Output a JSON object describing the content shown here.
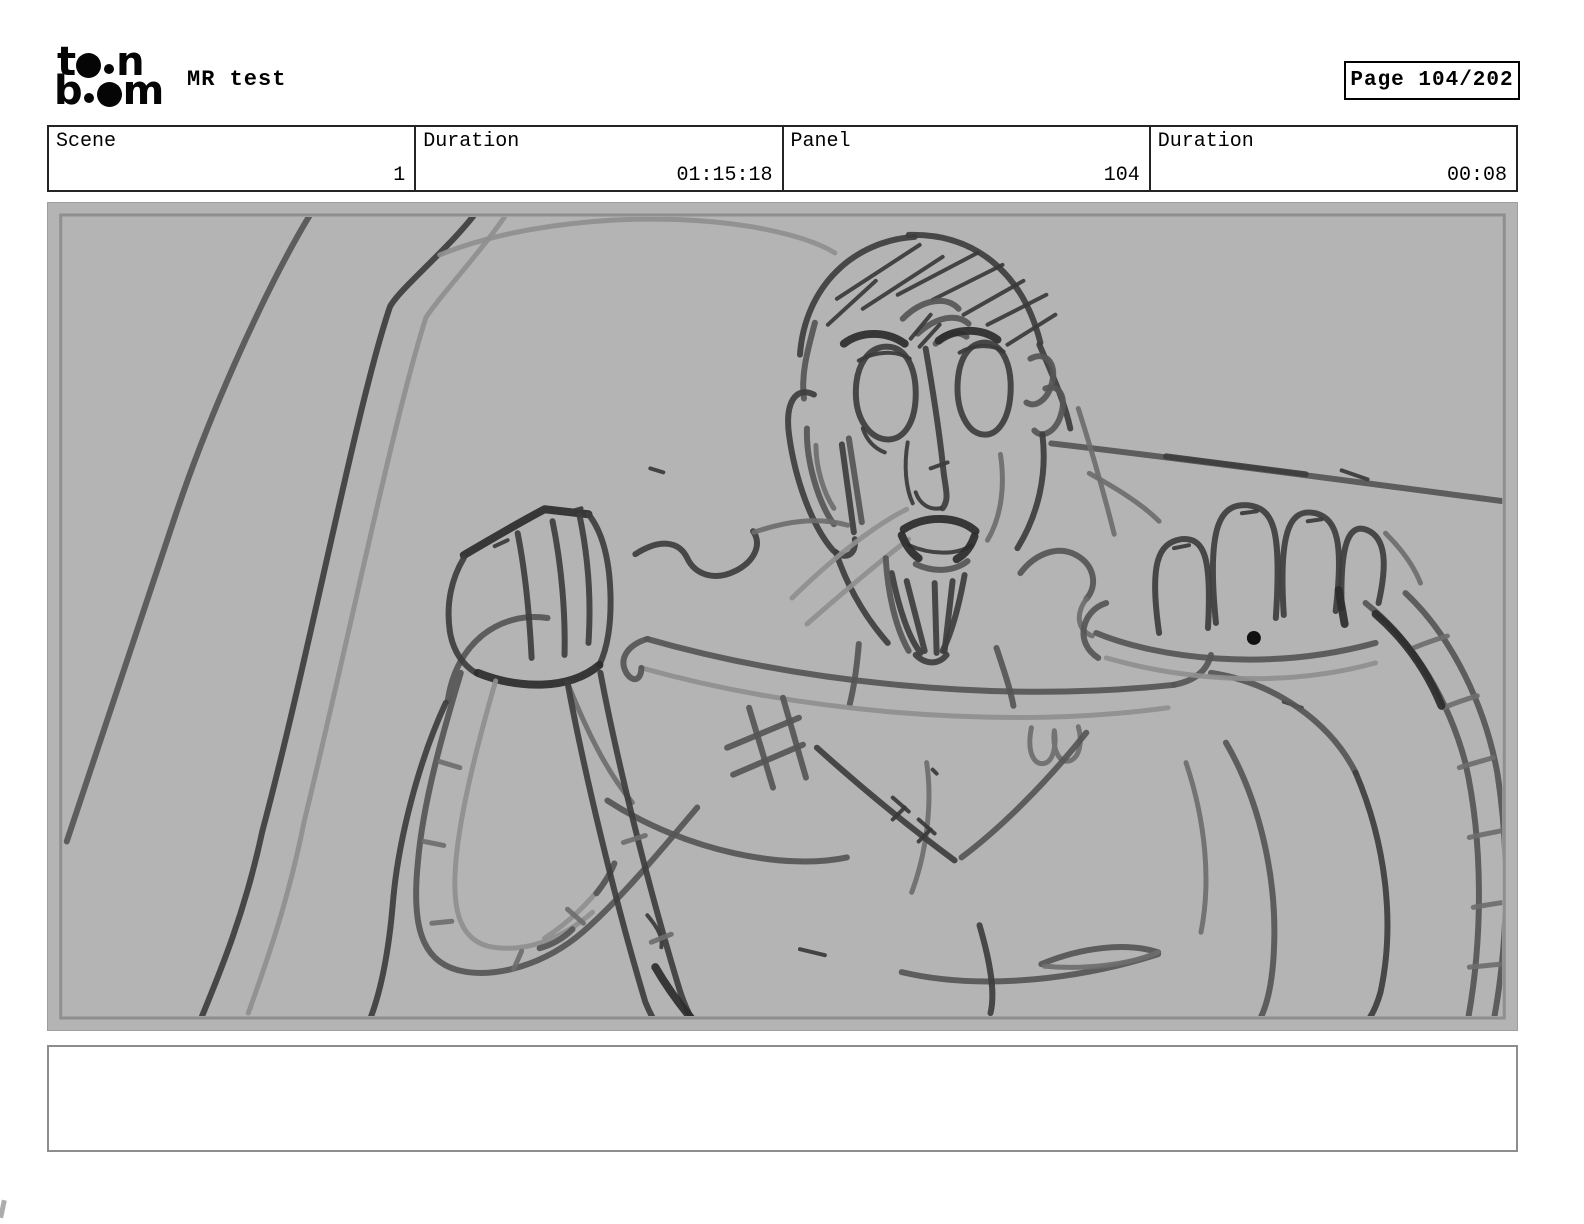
{
  "header": {
    "logo": {
      "l1a": "t",
      "l1b": "n",
      "l2a": "b",
      "l2b": "m"
    },
    "title": "MR test",
    "page_label": "Page 104/202"
  },
  "info_table": {
    "cells": [
      {
        "label": "Scene",
        "value": "1"
      },
      {
        "label": "Duration",
        "value": "01:15:18"
      },
      {
        "label": "Panel",
        "value": "104"
      },
      {
        "label": "Duration",
        "value": "00:08"
      }
    ]
  },
  "panel": {
    "alt": "Rough pencil storyboard sketch: wide-eyed bearded man gripping harness straps at both shoulders with clenched fists, ribbed hoses trailing down; diagonal frame lines behind him",
    "background": "#b4b4b4",
    "inner_border": "#8f8f8f",
    "outer_border": "#9e9e9e",
    "ink": "#3e3e3e"
  },
  "caption": {
    "text": ""
  }
}
